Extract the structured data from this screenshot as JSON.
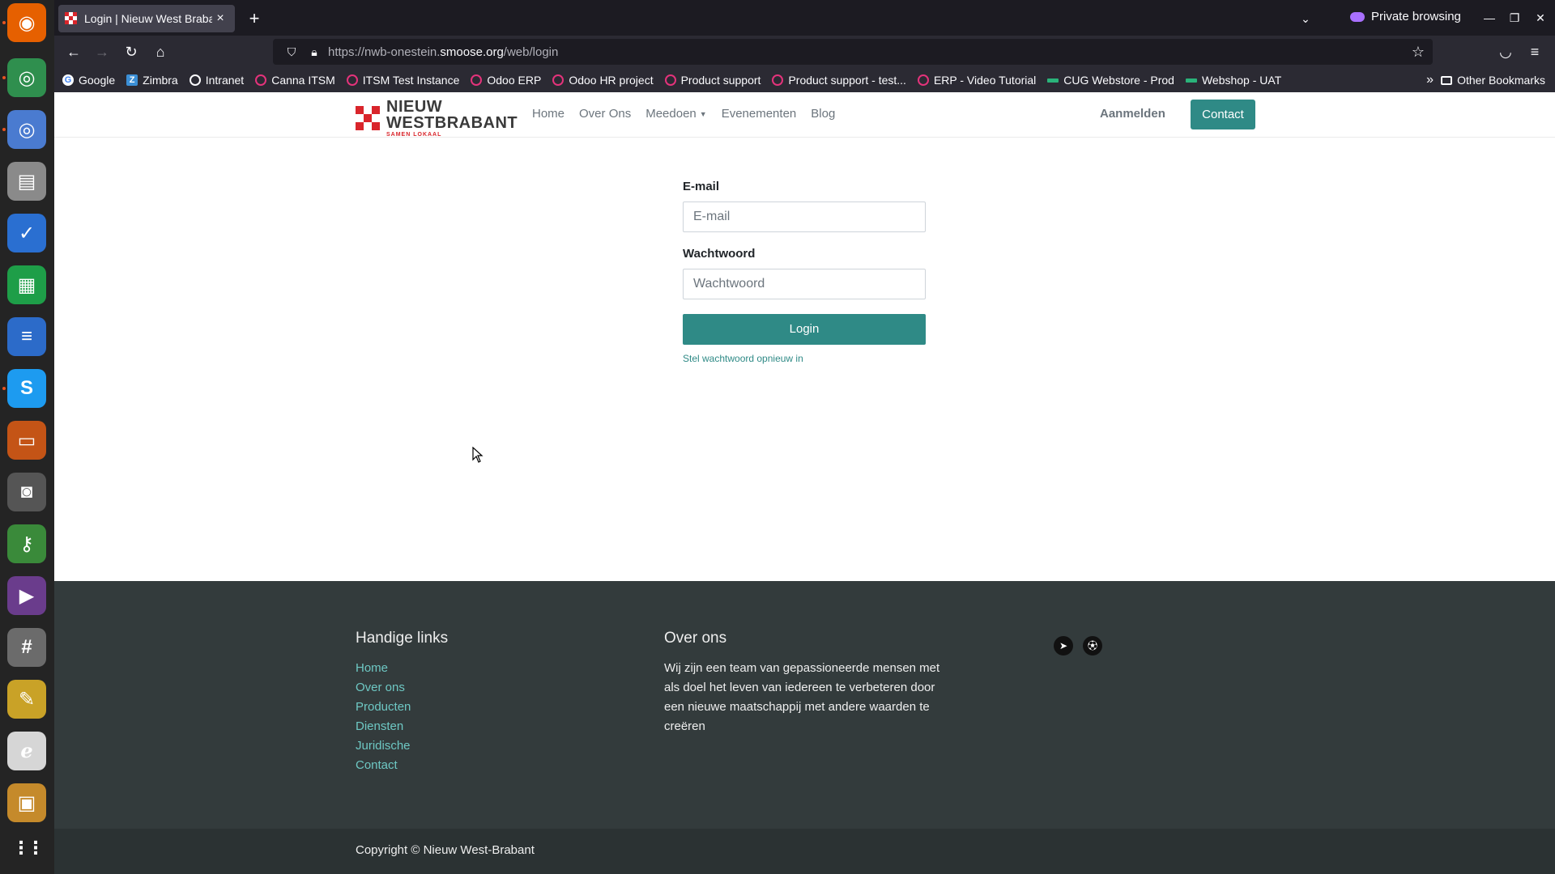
{
  "dock": {
    "items": [
      {
        "name": "firefox",
        "bg": "#e66000",
        "glyph": "◉"
      },
      {
        "name": "chrome",
        "bg": "#2f8f4e",
        "glyph": "◎"
      },
      {
        "name": "chromium",
        "bg": "#4a7bd0",
        "glyph": "◎"
      },
      {
        "name": "files",
        "bg": "#8a8a8a",
        "glyph": "▤"
      },
      {
        "name": "tasks",
        "bg": "#2a6fd1",
        "glyph": "✓"
      },
      {
        "name": "spreadsheet",
        "bg": "#1e9e48",
        "glyph": "▦"
      },
      {
        "name": "writer",
        "bg": "#2c6bc9",
        "glyph": "≡"
      },
      {
        "name": "skype",
        "bg": "#1d9bf0",
        "glyph": "S"
      },
      {
        "name": "impress",
        "bg": "#c45416",
        "glyph": "▭"
      },
      {
        "name": "camera",
        "bg": "#555555",
        "glyph": "◙"
      },
      {
        "name": "keepass",
        "bg": "#3a8a3a",
        "glyph": "⚷"
      },
      {
        "name": "video",
        "bg": "#6a3c8c",
        "glyph": "▶"
      },
      {
        "name": "calculator",
        "bg": "#6b6b6b",
        "glyph": "#"
      },
      {
        "name": "text-editor",
        "bg": "#c9a227",
        "glyph": "✎"
      },
      {
        "name": "pdf-viewer",
        "bg": "#d6d6d6",
        "glyph": "ℯ"
      },
      {
        "name": "image-viewer",
        "bg": "#c58a2b",
        "glyph": "▣"
      },
      {
        "name": "app-grid",
        "bg": "#242424",
        "glyph": "⋮⋮"
      }
    ]
  },
  "browser": {
    "tab_title": "Login | Nieuw West Brabant",
    "new_tab": "+",
    "private_label": "Private browsing",
    "url_prefix": "https://nwb-onestein.",
    "url_domain": "smoose.org",
    "url_suffix": "/web/login",
    "bookmarks": [
      {
        "label": "Google",
        "icon": "g"
      },
      {
        "label": "Zimbra",
        "icon": "z"
      },
      {
        "label": "Intranet",
        "icon": "globe"
      },
      {
        "label": "Canna ITSM",
        "icon": "odoo"
      },
      {
        "label": "ITSM Test Instance",
        "icon": "odoo"
      },
      {
        "label": "Odoo ERP",
        "icon": "odoo"
      },
      {
        "label": "Odoo HR project",
        "icon": "odoo"
      },
      {
        "label": "Product support",
        "icon": "odoo"
      },
      {
        "label": "Product support - test...",
        "icon": "odoo"
      },
      {
        "label": "ERP - Video Tutorial",
        "icon": "odoo"
      },
      {
        "label": "CUG Webstore - Prod",
        "icon": "bar"
      },
      {
        "label": "Webshop - UAT",
        "icon": "bar"
      }
    ],
    "other_bookmarks": "Other Bookmarks"
  },
  "site": {
    "logo": {
      "line1": "NIEUW",
      "line2": "WESTBRABANT",
      "line3": "SAMEN LOKAAL"
    },
    "menu": [
      "Home",
      "Over Ons",
      "Meedoen",
      "Evenementen",
      "Blog"
    ],
    "signin": "Aanmelden",
    "contact": "Contact",
    "brand_color": "#2f8a86"
  },
  "login": {
    "email_label": "E-mail",
    "email_placeholder": "E-mail",
    "password_label": "Wachtwoord",
    "password_placeholder": "Wachtwoord",
    "submit": "Login",
    "reset": "Stel wachtwoord opnieuw in"
  },
  "footer": {
    "links_title": "Handige links",
    "links": [
      "Home",
      "Over ons",
      "Producten",
      "Diensten",
      "Juridische",
      "Contact"
    ],
    "about_title": "Over ons",
    "about_text": "Wij zijn een team van gepassioneerde mensen met als doel het leven van iedereen te verbeteren door een nieuwe maatschappij met andere waarden te creëren",
    "socials": [
      "telegram-icon",
      "soccer-ball-icon"
    ],
    "copyright": "Copyright © Nieuw West-Brabant"
  }
}
